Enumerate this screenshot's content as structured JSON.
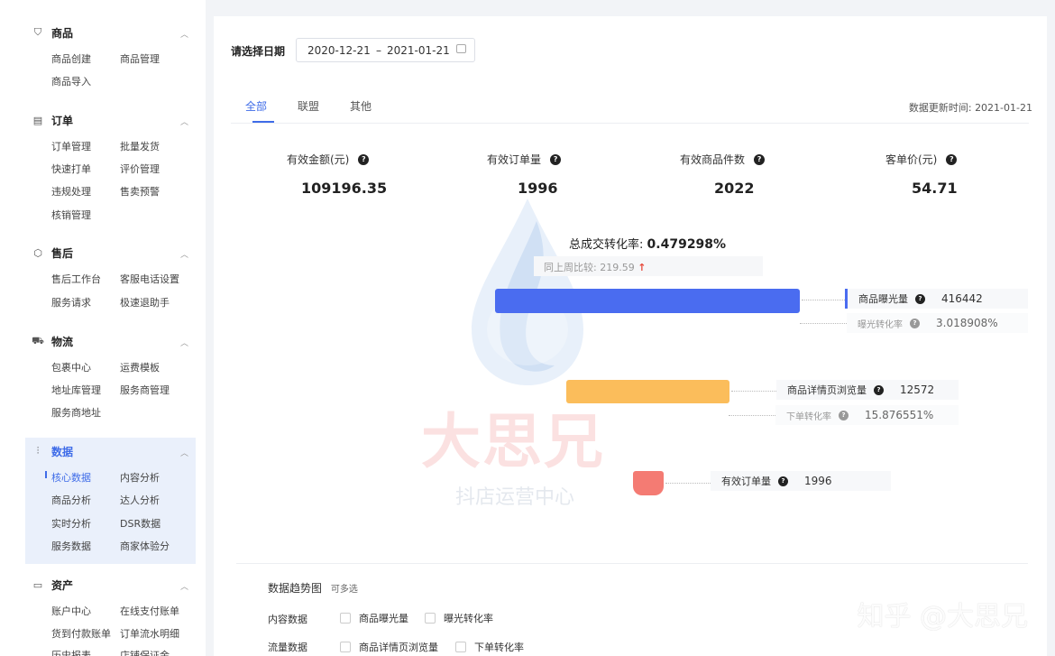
{
  "sidebar": {
    "groups": [
      {
        "icon": "bag-icon",
        "title": "商品",
        "items": [
          "商品创建",
          "商品管理",
          "商品导入"
        ]
      },
      {
        "icon": "order-icon",
        "title": "订单",
        "items": [
          "订单管理",
          "批量发货",
          "快速打单",
          "评价管理",
          "违规处理",
          "售卖预警",
          "核销管理"
        ]
      },
      {
        "icon": "box-icon",
        "title": "售后",
        "items": [
          "售后工作台",
          "客服电话设置",
          "服务请求",
          "极速退助手"
        ]
      },
      {
        "icon": "truck-icon",
        "title": "物流",
        "items": [
          "包裹中心",
          "运费模板",
          "地址库管理",
          "服务商管理",
          "服务商地址"
        ]
      },
      {
        "icon": "chart-icon",
        "title": "数据",
        "items": [
          "核心数据",
          "内容分析",
          "商品分析",
          "达人分析",
          "实时分析",
          "DSR数据",
          "服务数据",
          "商家体验分"
        ]
      },
      {
        "icon": "wallet-icon",
        "title": "资产",
        "items": [
          "账户中心",
          "在线支付账单",
          "货到付款账单",
          "订单流水明细",
          "历史报表",
          "店铺保证金"
        ]
      }
    ]
  },
  "filter": {
    "label": "请选择日期",
    "start_date": "2020-12-21",
    "separator": "–",
    "end_date": "2021-01-21"
  },
  "tabs": [
    "全部",
    "联盟",
    "其他"
  ],
  "active_tab": "全部",
  "update": {
    "label": "数据更新时间:",
    "value": "2021-01-21"
  },
  "metrics": [
    {
      "label": "有效金额(元)",
      "value": "109196.35"
    },
    {
      "label": "有效订单量",
      "value": "1996"
    },
    {
      "label": "有效商品件数",
      "value": "2022"
    },
    {
      "label": "客单价(元)",
      "value": "54.71"
    }
  ],
  "funnel": {
    "title": "总成交转化率:",
    "rate": "0.479298%",
    "compare_label": "同上周比较:",
    "compare_value": "219.59",
    "compare_arrow": "↑",
    "stages": [
      {
        "label": "商品曝光量",
        "value": "416442",
        "color": "#4a6cf0"
      },
      {
        "label": "商品详情页浏览量",
        "value": "12572",
        "color": "#fbbd5b"
      },
      {
        "label": "有效订单量",
        "value": "1996",
        "color": "#f47b73"
      }
    ],
    "rates": [
      {
        "label": "曝光转化率",
        "value": "3.018908%"
      },
      {
        "label": "下单转化率",
        "value": "15.876551%"
      }
    ]
  },
  "watermark": {
    "brand": "大思兄",
    "subtitle": "抖店运营中心",
    "zhihu": "知乎 @大思兄"
  },
  "trend": {
    "title": "数据趋势图",
    "hint": "可多选",
    "rows": [
      {
        "category": "内容数据",
        "options": [
          "商品曝光量",
          "曝光转化率"
        ]
      },
      {
        "category": "流量数据",
        "options": [
          "商品详情页浏览量",
          "下单转化率"
        ]
      }
    ]
  }
}
